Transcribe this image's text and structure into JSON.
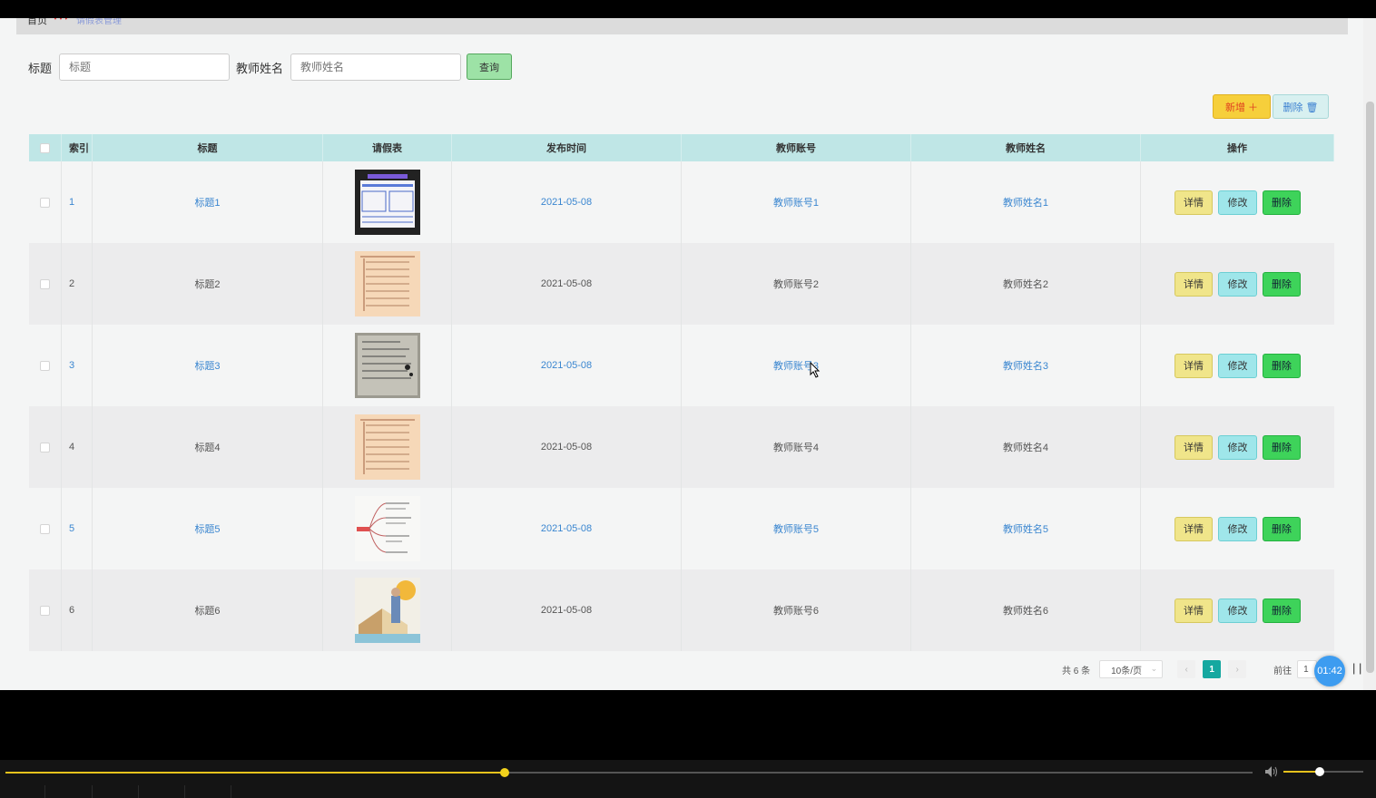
{
  "breadcrumb": {
    "home": "首页",
    "sub": "请假表管理"
  },
  "search": {
    "title_label": "标题",
    "title_placeholder": "标题",
    "teacher_label": "教师姓名",
    "teacher_placeholder": "教师姓名",
    "query_button": "查询"
  },
  "actions": {
    "add": "新增 ＋",
    "delete": "删除 🗑"
  },
  "table": {
    "headers": {
      "index": "索引",
      "title": "标题",
      "form": "请假表",
      "time": "发布时间",
      "account": "教师账号",
      "name": "教师姓名",
      "ops": "操作"
    },
    "rows": [
      {
        "index": "1",
        "title": "标题1",
        "time": "2021-05-08",
        "account": "教师账号1",
        "name": "教师姓名1"
      },
      {
        "index": "2",
        "title": "标题2",
        "time": "2021-05-08",
        "account": "教师账号2",
        "name": "教师姓名2"
      },
      {
        "index": "3",
        "title": "标题3",
        "time": "2021-05-08",
        "account": "教师账号3",
        "name": "教师姓名3"
      },
      {
        "index": "4",
        "title": "标题4",
        "time": "2021-05-08",
        "account": "教师账号4",
        "name": "教师姓名4"
      },
      {
        "index": "5",
        "title": "标题5",
        "time": "2021-05-08",
        "account": "教师账号5",
        "name": "教师姓名5"
      },
      {
        "index": "6",
        "title": "标题6",
        "time": "2021-05-08",
        "account": "教师账号6",
        "name": "教师姓名6"
      }
    ],
    "op_labels": {
      "detail": "详情",
      "edit": "修改",
      "delete": "删除"
    }
  },
  "pagination": {
    "total": "共 6 条",
    "page_size": "10条/页",
    "current": "1",
    "goto": "前往",
    "goto_value": "1"
  },
  "player": {
    "timer": "01:42",
    "progress": 0.4,
    "volume": 0.45
  },
  "colors": {
    "accent": "#16a8a0",
    "link": "#3a86d0",
    "add": "#f6cf3b",
    "header": "#bfe6e6",
    "progress": "#e6c21c"
  }
}
